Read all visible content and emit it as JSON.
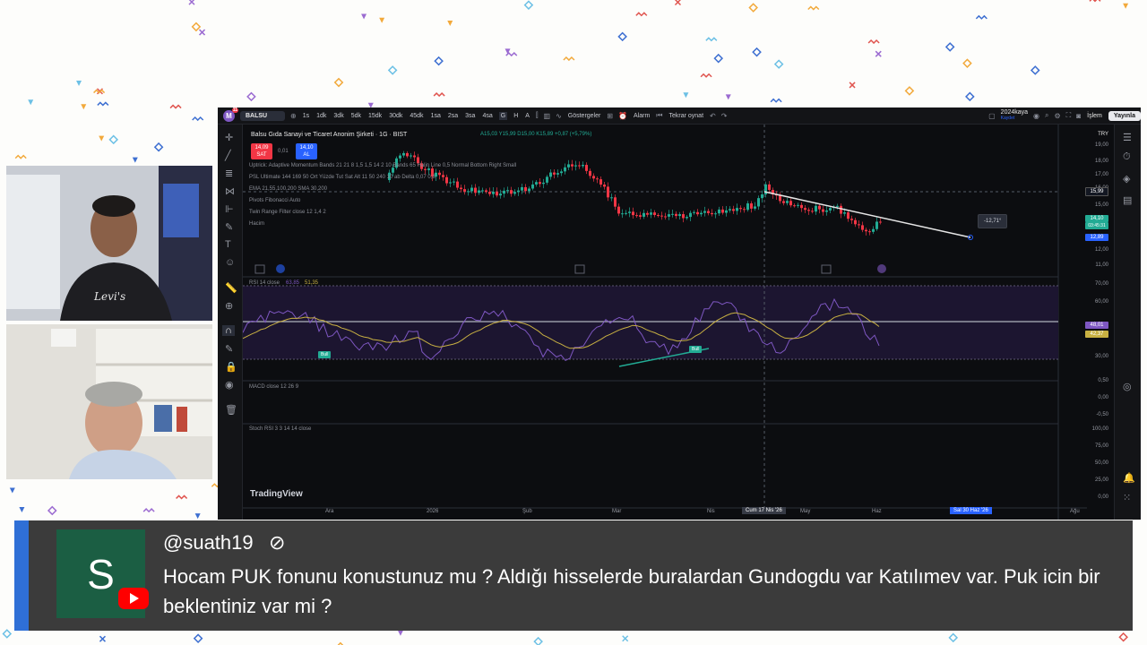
{
  "toolbar": {
    "logo_letter": "M",
    "notification_count": "11",
    "symbol": "BALSU",
    "timeframes": [
      "1s",
      "1dk",
      "3dk",
      "5dk",
      "15dk",
      "30dk",
      "45dk",
      "1sa",
      "2sa",
      "3sa",
      "4sa",
      "G",
      "H",
      "A"
    ],
    "indicators_label": "Göstergeler",
    "alarm_label": "Alarm",
    "replay_label": "Tekrar oynat",
    "username": "2024kaya",
    "user_sub": "Kaydet",
    "trade_label": "İşlem",
    "publish_label": "Yayınla",
    "currency": "TRY"
  },
  "legend": {
    "title": "Balsu Gıda Sanayi ve Ticaret Anonim Şirketi · 1G · BIST",
    "ohlc": "A15,03 Y15,99 D15,00 K15,89 +0,87 (+5,79%)",
    "sell_price": "14,09",
    "sell_label": "SAT",
    "spread": "0,01",
    "buy_price": "14,10",
    "buy_label": "AL",
    "indicators": [
      "Uptrick: Adaptive Momentum Bands 21 21 8 1,5 1,5 14 2 10 Bands 65 Halin Line 0,5 Normal Bottom Right Small",
      "PSL Ultimate 144 169 50 Ort Yüzde Tut Sat Alt 11 50 240 10 ab Delta 0,07 0,8",
      "EMA 21,55,100,200 SMA 30,200",
      "Pivots Fibonacci Auto",
      "Twin Range Filter close 12 1,4 2",
      "Hacim"
    ]
  },
  "rsi": {
    "label": "RSI 14 close",
    "v1": "63,85",
    "v2": "51,35",
    "bull_label": "Bull"
  },
  "macd_label": "MACD close 12 26 9",
  "stoch_label": "Stoch RSI 3 3 14 14 close",
  "price_axis": {
    "labels": [
      "19,00",
      "18,00",
      "17,00",
      "16,00",
      "15,00",
      "13,00",
      "12,00",
      "11,00"
    ],
    "tag_high": "15,99",
    "tag_last": "14,10",
    "tag_last_time": "03:45:31",
    "tag_low": "12,89",
    "rsi_labels": [
      "70,00",
      "60,00",
      "30,00",
      "0,50"
    ],
    "rsi_tag1": "48,01",
    "rsi_tag2": "42,37",
    "macd_labels": [
      "0,00",
      "-0,50"
    ],
    "stoch_labels": [
      "100,00",
      "75,00",
      "50,00",
      "25,00",
      "0,00"
    ]
  },
  "time_axis": {
    "labels": [
      "Ara",
      "2026",
      "Şub",
      "Mar",
      "Nis",
      "May",
      "Haz",
      "Ağu"
    ],
    "cursor_tag": "Cum 17 Nis '26",
    "end_tag": "Sal 30 Haz '26"
  },
  "measure": "-12,71°",
  "watermark": "TradingView",
  "chat": {
    "avatar_letter": "S",
    "username": "@suath19",
    "message": "Hocam PUK fonunu konustunuz mu ? Aldığı hisselerde buralardan Gundogdu var Katılımev var. Puk icin bir beklentiniz var mi ?"
  },
  "colors": {
    "up": "#22ab94",
    "down": "#f23645",
    "accent": "#2962ff",
    "banner_edge": "#2f6fd6"
  }
}
